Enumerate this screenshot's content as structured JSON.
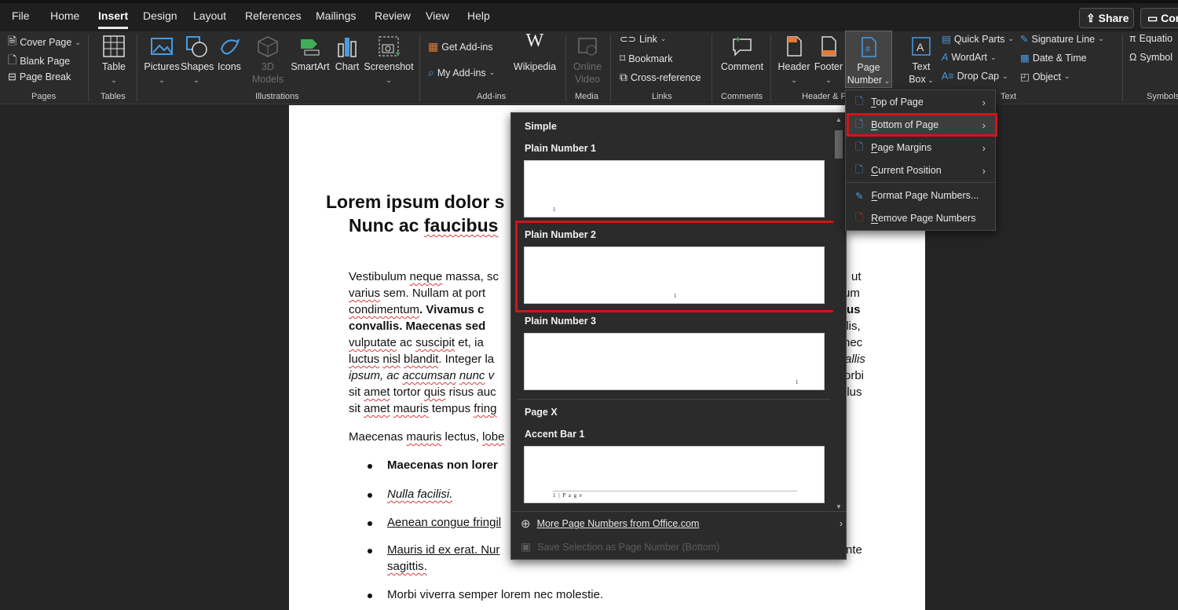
{
  "menubar": {
    "tabs": [
      "File",
      "Home",
      "Insert",
      "Design",
      "Layout",
      "References",
      "Mailings",
      "Review",
      "View",
      "Help"
    ],
    "active_tab": "Insert",
    "share_label": "Share",
    "comments_label": "Com"
  },
  "ribbon": {
    "pages": {
      "cover_page": "Cover Page",
      "blank_page": "Blank Page",
      "page_break": "Page Break",
      "label": "Pages"
    },
    "tables": {
      "table": "Table",
      "label": "Tables"
    },
    "illustrations": {
      "pictures": "Pictures",
      "shapes": "Shapes",
      "icons": "Icons",
      "models_line1": "3D",
      "models_line2": "Models",
      "smartart": "SmartArt",
      "chart": "Chart",
      "screenshot": "Screenshot",
      "label": "Illustrations"
    },
    "addins": {
      "get_addins": "Get Add-ins",
      "my_addins": "My Add-ins",
      "wikipedia": "Wikipedia",
      "label": "Add-ins"
    },
    "media": {
      "online_line1": "Online",
      "online_line2": "Video",
      "label": "Media"
    },
    "links": {
      "link": "Link",
      "bookmark": "Bookmark",
      "cross_reference": "Cross-reference",
      "label": "Links"
    },
    "comments": {
      "comment": "Comment",
      "label": "Comments"
    },
    "header_footer": {
      "header": "Header",
      "footer": "Footer",
      "page_line1": "Page",
      "page_line2": "Number",
      "label": "Header & F"
    },
    "text": {
      "textbox_line1": "Text",
      "textbox_line2": "Box",
      "quick_parts": "Quick Parts",
      "wordart": "WordArt",
      "drop_cap": "Drop Cap",
      "signature_line": "Signature Line",
      "date_time": "Date & Time",
      "object": "Object",
      "label": "Text"
    },
    "symbols": {
      "equation": "Equatio",
      "symbol": "Symbol",
      "label": "Symbols"
    }
  },
  "document": {
    "title_line1": "Lorem ipsum dolor s",
    "title_line2_pre": "Nunc ac ",
    "title_line2_sq": "faucibus",
    "para_lines": [
      [
        "Vestibulum ",
        "neque",
        " massa, sc"
      ],
      [
        "varius",
        " sem.  Nullam  at  port"
      ],
      [
        "condimentum",
        ".   Vivamus  c"
      ],
      [
        "convallis.  Maecenas  sed  ",
        "",
        ""
      ],
      [
        "vulputate",
        " ac  ",
        "suscipit",
        "  et,  ia"
      ],
      [
        "luctus",
        " ",
        "nisl",
        " ",
        "blandit",
        ". Integer la"
      ],
      [
        "ipsum, ac ",
        "accumsan",
        " ",
        "nunc",
        " v"
      ],
      [
        "sit ",
        "amet",
        " tortor ",
        "quis",
        " risus auc"
      ],
      [
        "sit ",
        "amet",
        " ",
        "mauris",
        " tempus ",
        "fring"
      ]
    ],
    "right_fragments": [
      "ut",
      "um",
      "us",
      "elis,",
      "nec",
      "allis",
      "orbi",
      "llus"
    ],
    "para2": [
      "Maecenas ",
      "mauris",
      " lectus, ",
      "lobe"
    ],
    "bullets": [
      "Maecenas non lorer",
      "Nulla facilisi.",
      "Aenean congue fringil",
      "Mauris id ex erat. Nur",
      "Morbi viverra semper lorem nec molestie."
    ],
    "bullet4_line2": "sagittis.",
    "bullet4_right": "nte"
  },
  "gallery": {
    "section_simple": "Simple",
    "items": [
      {
        "label": "Plain Number 1",
        "number": "1"
      },
      {
        "label": "Plain Number 2",
        "number": "1"
      },
      {
        "label": "Plain Number 3",
        "number": "1"
      }
    ],
    "section_pagex": "Page X",
    "accent_bar": {
      "label": "Accent Bar 1",
      "number_text": "1 | P a g e"
    },
    "more_from_office": "More Page Numbers from Office.com",
    "save_selection": "Save Selection as Page Number (Bottom)"
  },
  "submenu": {
    "items": [
      {
        "label_u": "T",
        "label_rest": "op of Page",
        "has_arrow": true
      },
      {
        "label_u": "B",
        "label_rest": "ottom of Page",
        "has_arrow": true
      },
      {
        "label_u": "P",
        "label_rest": "age Margins",
        "has_arrow": true
      },
      {
        "label_u": "C",
        "label_rest": "urrent Position",
        "has_arrow": true
      },
      {
        "label_u": "F",
        "label_rest": "ormat Page Numbers...",
        "has_arrow": false
      },
      {
        "label_u": "R",
        "label_rest": "emove Page Numbers",
        "has_arrow": false
      }
    ]
  },
  "colors": {
    "highlight": "#d31417",
    "icon_blue": "#4a9be0",
    "icon_orange": "#e07b3a",
    "icon_green": "#3fae5a"
  }
}
